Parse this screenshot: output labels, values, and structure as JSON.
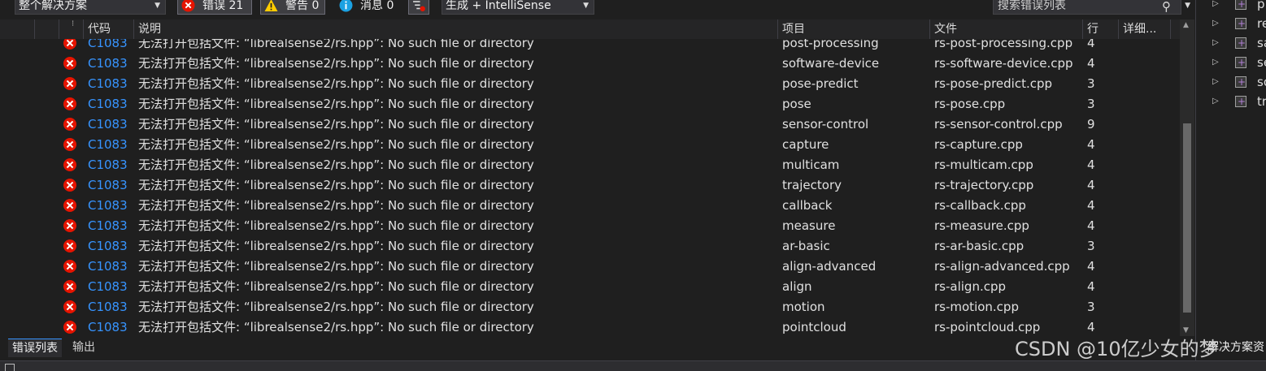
{
  "toolbar": {
    "scope_dropdown": "整个解决方案",
    "errors_label": "错误 21",
    "warnings_label": "警告 0",
    "messages_label": "消息 0",
    "build_dropdown": "生成 + IntelliSense",
    "search_placeholder": "搜索错误列表"
  },
  "header": {
    "code": "代码",
    "description": "说明",
    "project": "项目",
    "file": "文件",
    "line": "行",
    "details": "详细..."
  },
  "rows": [
    {
      "code": "C1083",
      "desc": "无法打开包括文件: “librealsense2/rs.hpp”: No such file or directory",
      "project": "post-processing",
      "file": "rs-post-processing.cpp",
      "line": "4"
    },
    {
      "code": "C1083",
      "desc": "无法打开包括文件: “librealsense2/rs.hpp”: No such file or directory",
      "project": "software-device",
      "file": "rs-software-device.cpp",
      "line": "4"
    },
    {
      "code": "C1083",
      "desc": "无法打开包括文件: “librealsense2/rs.hpp”: No such file or directory",
      "project": "pose-predict",
      "file": "rs-pose-predict.cpp",
      "line": "3"
    },
    {
      "code": "C1083",
      "desc": "无法打开包括文件: “librealsense2/rs.hpp”: No such file or directory",
      "project": "pose",
      "file": "rs-pose.cpp",
      "line": "3"
    },
    {
      "code": "C1083",
      "desc": "无法打开包括文件: “librealsense2/rs.hpp”: No such file or directory",
      "project": "sensor-control",
      "file": "rs-sensor-control.cpp",
      "line": "9"
    },
    {
      "code": "C1083",
      "desc": "无法打开包括文件: “librealsense2/rs.hpp”: No such file or directory",
      "project": "capture",
      "file": "rs-capture.cpp",
      "line": "4"
    },
    {
      "code": "C1083",
      "desc": "无法打开包括文件: “librealsense2/rs.hpp”: No such file or directory",
      "project": "multicam",
      "file": "rs-multicam.cpp",
      "line": "4"
    },
    {
      "code": "C1083",
      "desc": "无法打开包括文件: “librealsense2/rs.hpp”: No such file or directory",
      "project": "trajectory",
      "file": "rs-trajectory.cpp",
      "line": "4"
    },
    {
      "code": "C1083",
      "desc": "无法打开包括文件: “librealsense2/rs.hpp”: No such file or directory",
      "project": "callback",
      "file": "rs-callback.cpp",
      "line": "4"
    },
    {
      "code": "C1083",
      "desc": "无法打开包括文件: “librealsense2/rs.hpp”: No such file or directory",
      "project": "measure",
      "file": "rs-measure.cpp",
      "line": "4"
    },
    {
      "code": "C1083",
      "desc": "无法打开包括文件: “librealsense2/rs.hpp”: No such file or directory",
      "project": "ar-basic",
      "file": "rs-ar-basic.cpp",
      "line": "3"
    },
    {
      "code": "C1083",
      "desc": "无法打开包括文件: “librealsense2/rs.hpp”: No such file or directory",
      "project": "align-advanced",
      "file": "rs-align-advanced.cpp",
      "line": "4"
    },
    {
      "code": "C1083",
      "desc": "无法打开包括文件: “librealsense2/rs.hpp”: No such file or directory",
      "project": "align",
      "file": "rs-align.cpp",
      "line": "4"
    },
    {
      "code": "C1083",
      "desc": "无法打开包括文件: “librealsense2/rs.hpp”: No such file or directory",
      "project": "motion",
      "file": "rs-motion.cpp",
      "line": "3"
    },
    {
      "code": "C1083",
      "desc": "无法打开包括文件: “librealsense2/rs.hpp”: No such file or directory",
      "project": "pointcloud",
      "file": "rs-pointcloud.cpp",
      "line": "4"
    }
  ],
  "tabs": {
    "error_list": "错误列表",
    "output": "输出"
  },
  "explorer": {
    "items": [
      "p",
      "re",
      "sa",
      "se",
      "so",
      "tr"
    ],
    "bottom_tab": "解决方案资"
  },
  "watermark": "CSDN @10亿少女的梦",
  "colors": {
    "error_red": "#e51400",
    "code_link_blue": "#3794ff",
    "background": "#1f1f1f"
  },
  "icons": {
    "errors": "error-icon",
    "warnings": "warning-icon",
    "messages": "info-icon",
    "search": "search-icon"
  }
}
